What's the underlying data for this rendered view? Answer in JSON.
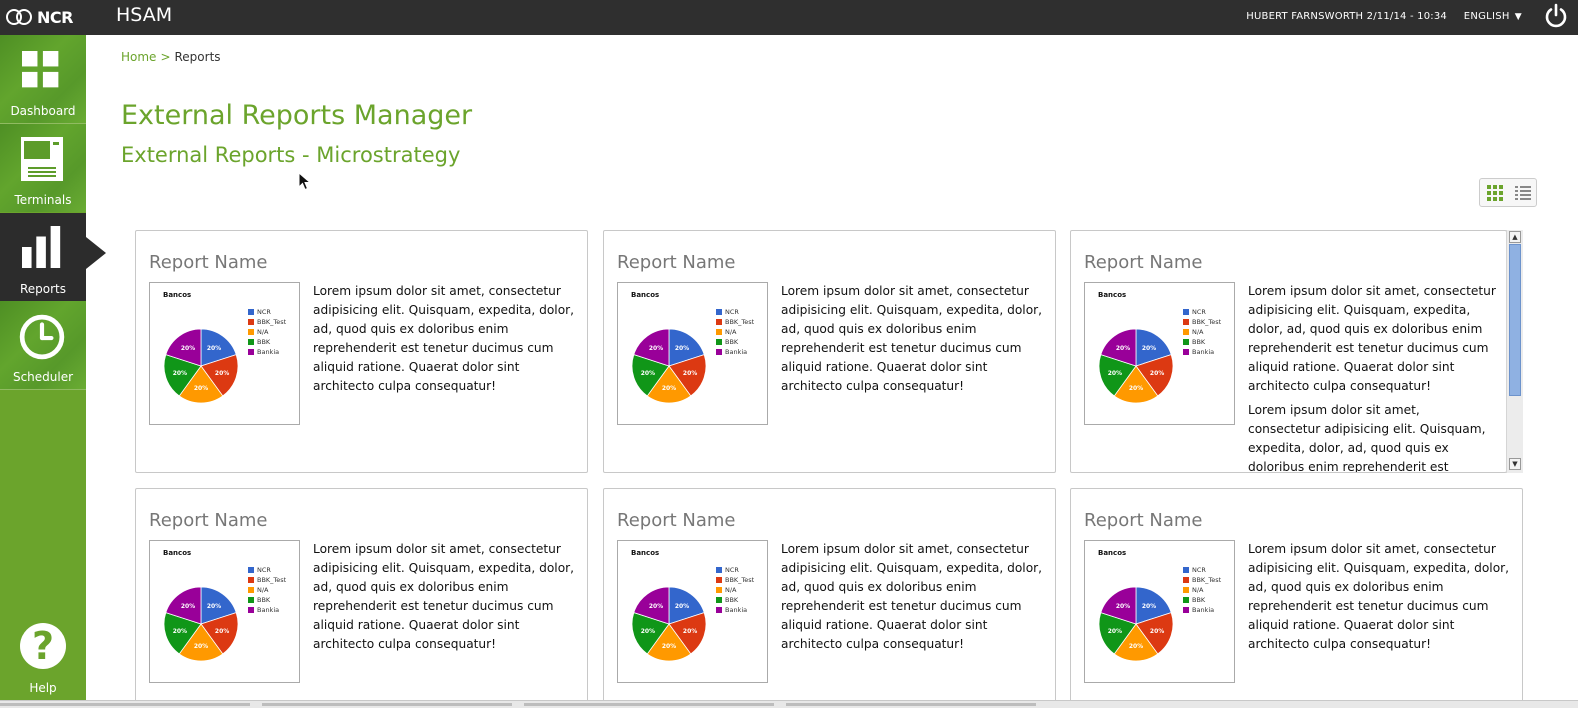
{
  "app": {
    "logo_text": "NCR",
    "title": "HSAM"
  },
  "header": {
    "user": "HUBERT FARNSWORTH",
    "datetime": "2/11/14 - 10:34",
    "language": "ENGLISH"
  },
  "sidebar": {
    "items": [
      {
        "label": "Dashboard",
        "icon": "dashboard-grid-icon",
        "active": false
      },
      {
        "label": "Terminals",
        "icon": "terminal-icon",
        "active": false
      },
      {
        "label": "Reports",
        "icon": "bar-chart-icon",
        "active": true
      },
      {
        "label": "Scheduler",
        "icon": "clock-icon",
        "active": false
      }
    ],
    "help_label": "Help",
    "help_glyph": "?"
  },
  "breadcrumb": {
    "home": "Home",
    "separator": ">",
    "current": "Reports"
  },
  "page": {
    "title": "External Reports Manager",
    "subtitle": "External Reports - Microstrategy"
  },
  "colors": {
    "accent": "#6ba42c",
    "topbar": "#2f2f2f",
    "pie": [
      "#3366cc",
      "#dc3912",
      "#ff9900",
      "#109618",
      "#990099"
    ]
  },
  "thumbnail": {
    "title": "Bancos",
    "legend": [
      "NCR",
      "BBK_Test",
      "N/A",
      "BBK",
      "Bankia"
    ],
    "slice_label": "20%"
  },
  "reports": [
    {
      "name": "Report Name",
      "description": "Lorem ipsum dolor sit amet, consectetur adipisicing elit. Quisquam, expedita, dolor, ad, quod quis ex doloribus enim reprehenderit est tenetur ducimus cum aliquid ratione. Quaerat dolor sint architecto culpa consequatur!"
    },
    {
      "name": "Report Name",
      "description": "Lorem ipsum dolor sit amet, consectetur adipisicing elit. Quisquam, expedita, dolor, ad, quod quis ex doloribus enim reprehenderit est tenetur ducimus cum aliquid ratione. Quaerat dolor sint architecto culpa consequatur!"
    },
    {
      "name": "Report Name",
      "description": "Lorem ipsum dolor sit amet, consectetur adipisicing elit. Quisquam, expedita, dolor, ad, quod quis ex doloribus enim reprehenderit est tenetur ducimus cum aliquid ratione. Quaerat dolor sint architecto culpa consequatur!",
      "description_extra": "Lorem ipsum dolor sit amet, consectetur adipisicing elit. Quisquam, expedita, dolor, ad, quod quis ex doloribus enim reprehenderit est tenetur ducimus cum aliquid ratione. Quaerat dolor sint architecto culpa consequatur!"
    },
    {
      "name": "Report Name",
      "description": "Lorem ipsum dolor sit amet, consectetur adipisicing elit. Quisquam, expedita, dolor, ad, quod quis ex doloribus enim reprehenderit est tenetur ducimus cum aliquid ratione. Quaerat dolor sint architecto culpa consequatur!"
    },
    {
      "name": "Report Name",
      "description": "Lorem ipsum dolor sit amet, consectetur adipisicing elit. Quisquam, expedita, dolor, ad, quod quis ex doloribus enim reprehenderit est tenetur ducimus cum aliquid ratione. Quaerat dolor sint architecto culpa consequatur!"
    },
    {
      "name": "Report Name",
      "description": "Lorem ipsum dolor sit amet, consectetur adipisicing elit. Quisquam, expedita, dolor, ad, quod quis ex doloribus enim reprehenderit est tenetur ducimus cum aliquid ratione. Quaerat dolor sint architecto culpa consequatur!"
    }
  ]
}
